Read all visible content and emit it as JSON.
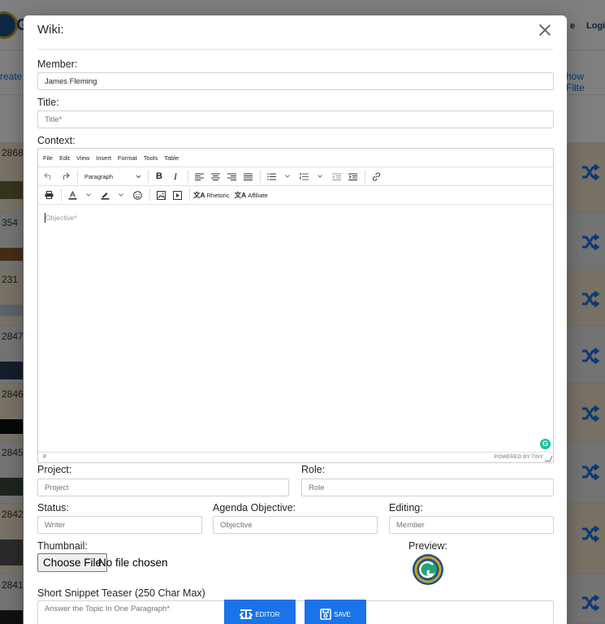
{
  "background": {
    "brand_letter": "G",
    "nav": {
      "link_1": "e",
      "link_2": "Logi"
    },
    "subnav": {
      "left_link": "reate",
      "right_link": "how Filte"
    },
    "rows": [
      {
        "id": "2868",
        "tone": "tan"
      },
      {
        "id": "354",
        "tone": "grey"
      },
      {
        "id": "231",
        "tone": "tan"
      },
      {
        "id": "2847",
        "tone": "grey"
      },
      {
        "id": "2846",
        "tone": "tan"
      },
      {
        "id": "2845",
        "tone": "grey"
      },
      {
        "id": "2842",
        "tone": "tan"
      },
      {
        "id": "2841",
        "tone": "grey"
      }
    ]
  },
  "modal": {
    "title": "Wiki:",
    "member": {
      "label": "Member:",
      "value": "James Fleming"
    },
    "title_field": {
      "label": "Title:",
      "placeholder": "Title*"
    },
    "context": {
      "label": "Context:",
      "menus": [
        "File",
        "Edit",
        "View",
        "Insert",
        "Format",
        "Tools",
        "Table"
      ],
      "block_format": "Paragraph",
      "ext_buttons": {
        "rhetoric": "Rhetoric",
        "affiliate": "Affiliate"
      },
      "placeholder": "Objective*",
      "path": "P",
      "brand": "POWERED BY TINY"
    },
    "project": {
      "label": "Project:",
      "placeholder": "Project"
    },
    "role": {
      "label": "Role:",
      "placeholder": "Role"
    },
    "status": {
      "label": "Status:",
      "placeholder": "Writer"
    },
    "agenda_objective": {
      "label": "Agenda Objective:",
      "placeholder": "Objective"
    },
    "editing": {
      "label": "Editing:",
      "placeholder": "Member"
    },
    "thumbnail": {
      "label": "Thumbnail:",
      "button": "Choose File",
      "status": "No file chosen"
    },
    "preview": {
      "label": "Preview:"
    },
    "snippet": {
      "label": "Short Snippet Teaser (250 Char Max)",
      "placeholder": "Answer the Topic In One Paragraph*"
    },
    "buttons": {
      "editor": "EDITOR",
      "save": "SAVE"
    },
    "accent_color": "#1a73e8"
  }
}
